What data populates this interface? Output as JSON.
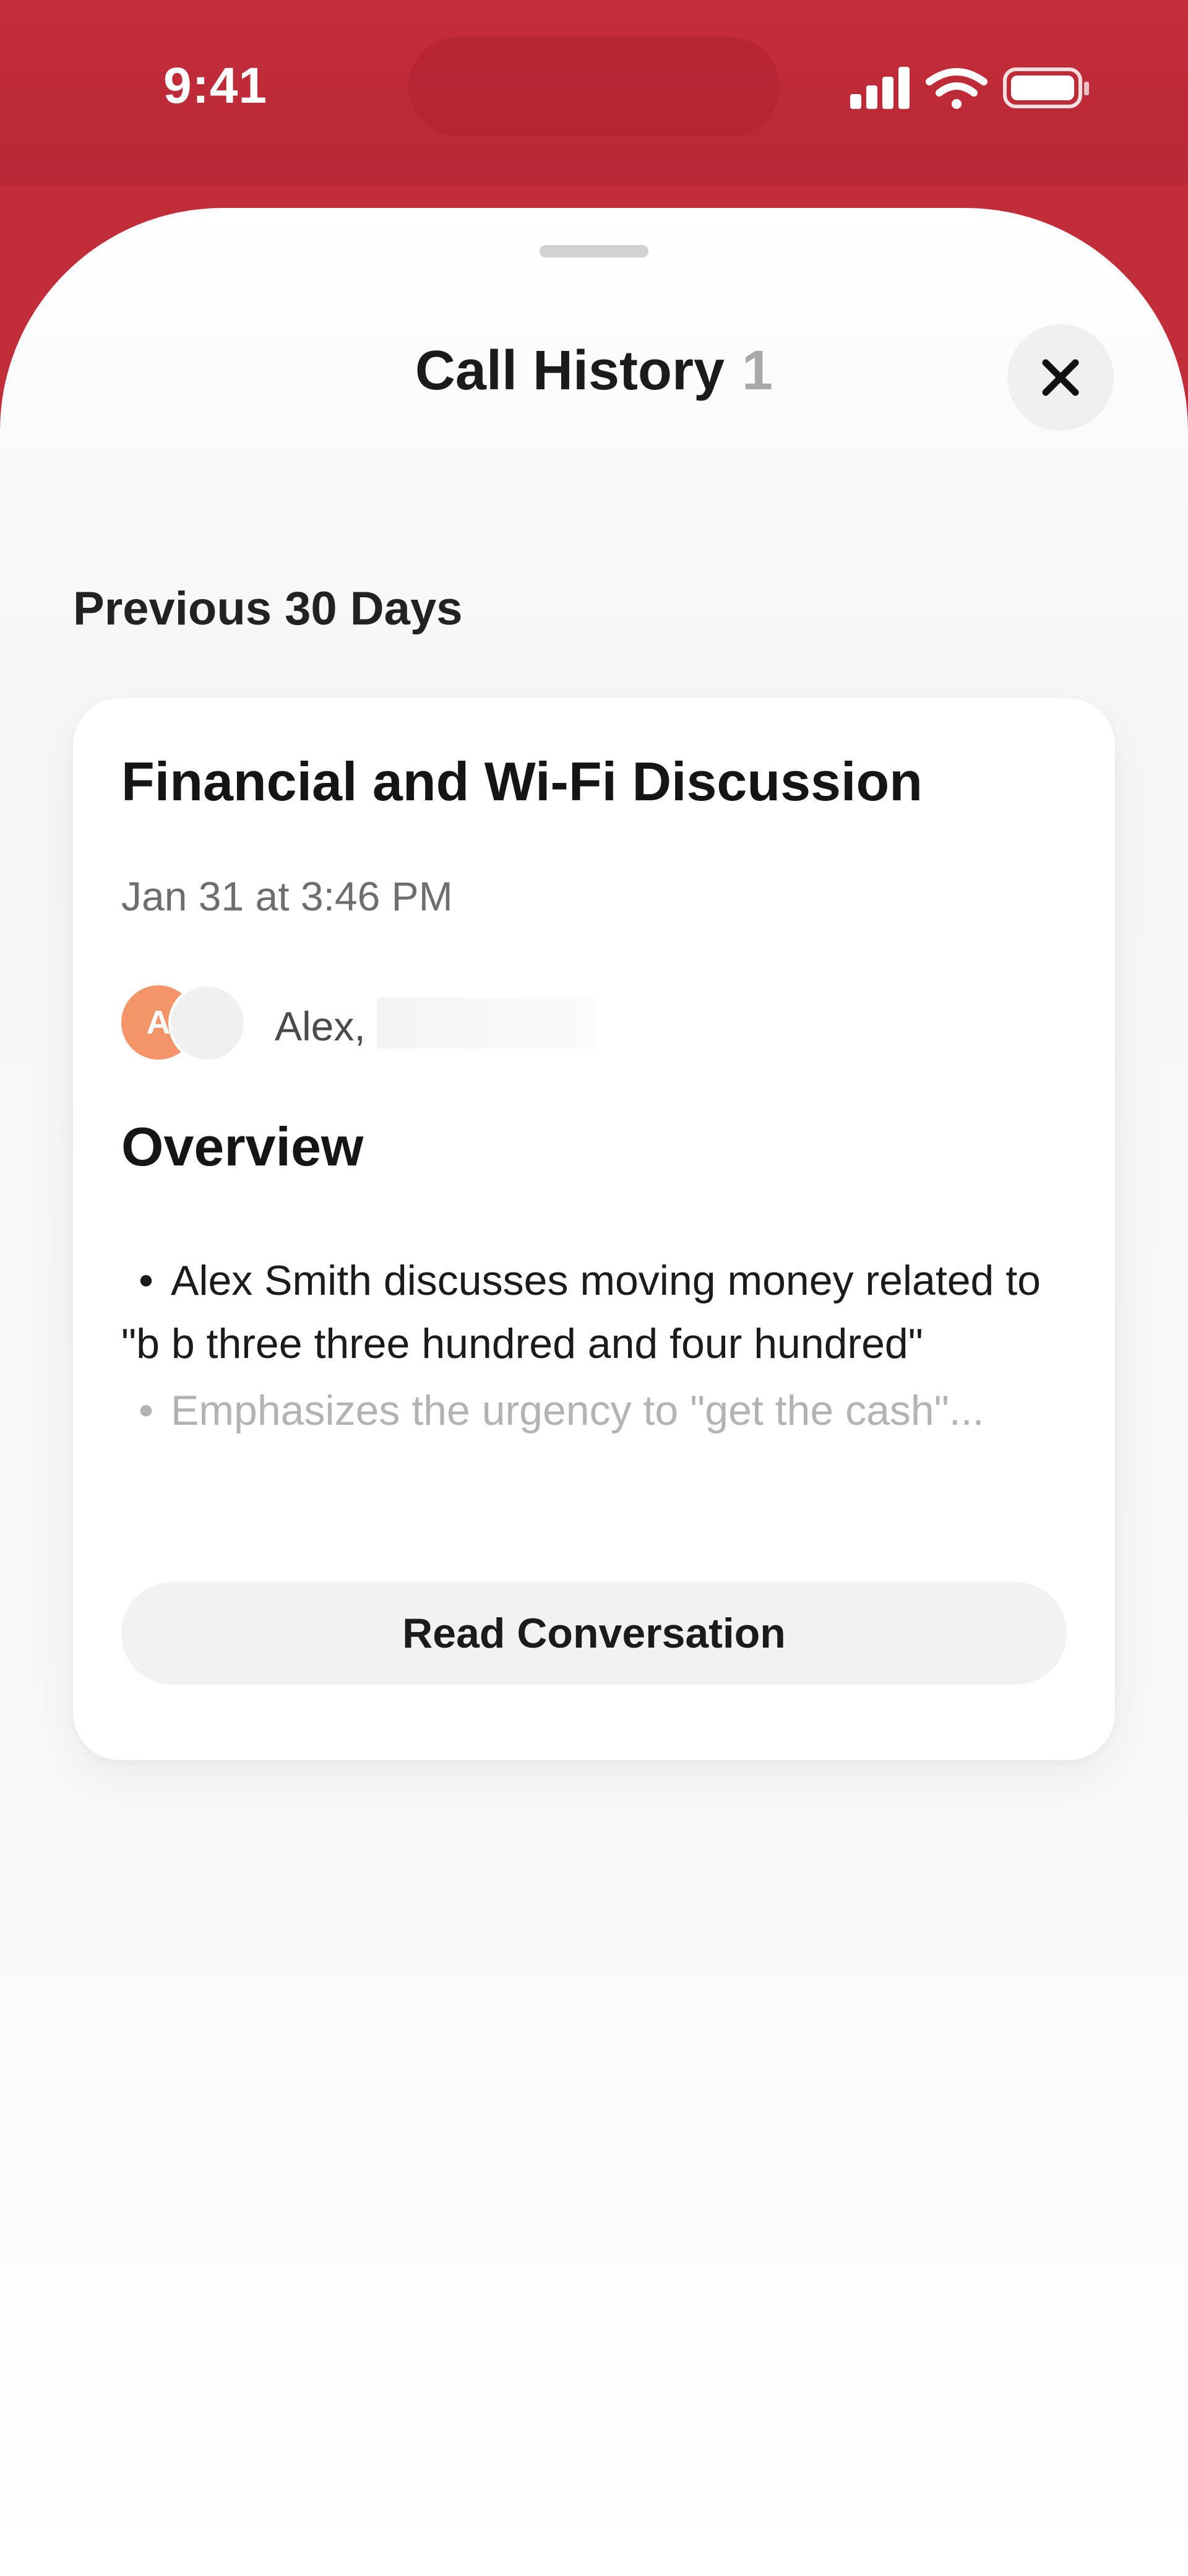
{
  "status_bar": {
    "time": "9:41",
    "icons": [
      "signal-icon",
      "wifi-icon",
      "battery-icon"
    ]
  },
  "header": {
    "title": "Call History",
    "count": "1",
    "close_icon": "close-icon"
  },
  "section": {
    "label": "Previous 30 Days"
  },
  "call_card": {
    "title": "Financial and Wi-Fi Discussion",
    "date": "Jan 31 at 3:46 PM",
    "avatar_initial": "A",
    "participants": "Alex,",
    "overview_heading": "Overview",
    "bullets": [
      "Alex Smith discusses moving money related to \"b b three three hundred and four hundred\"",
      "Emphasizes the urgency to \"get the cash\"..."
    ],
    "button_label": "Read Conversation"
  },
  "colors": {
    "header_background": "#c22d3a",
    "avatar_accent": "#f39469",
    "muted_text": "#b3b3b3"
  }
}
